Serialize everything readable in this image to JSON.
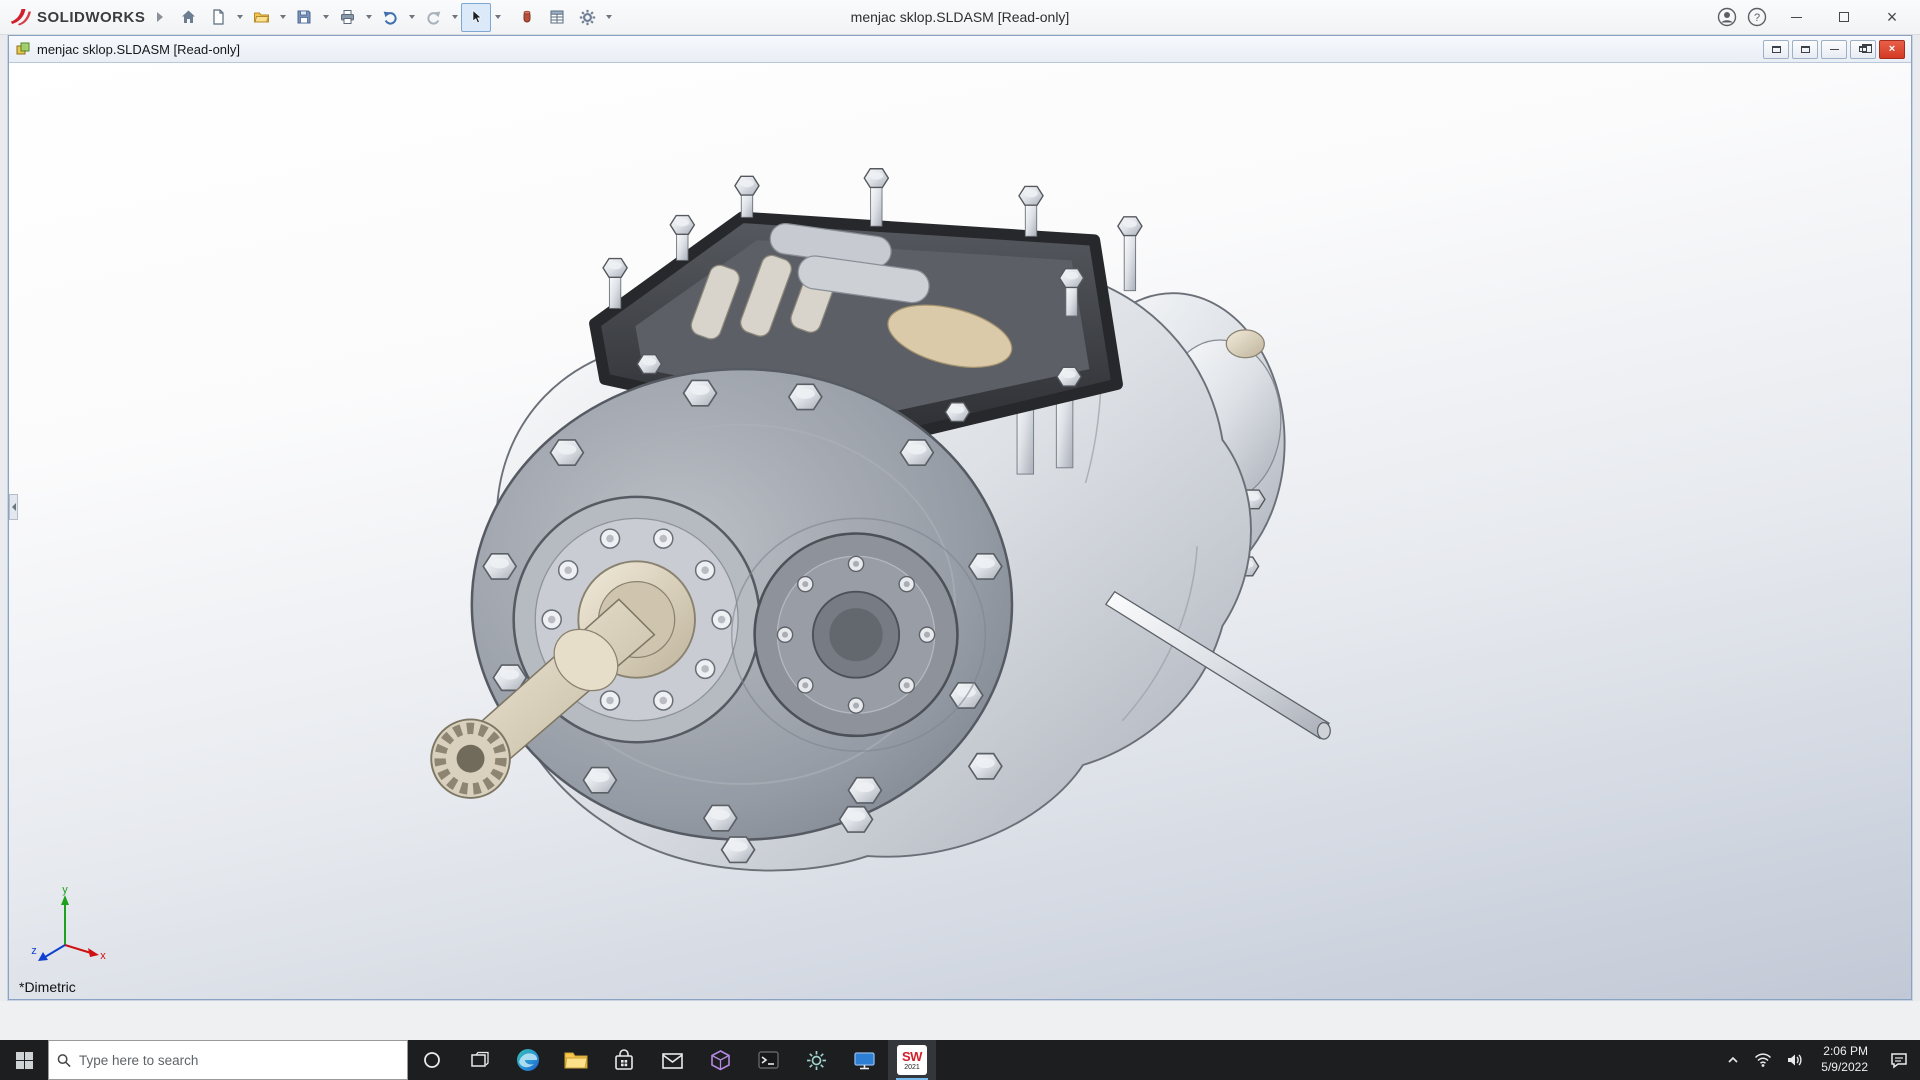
{
  "app": {
    "name": "SOLIDWORKS",
    "title_center": "menjac sklop.SLDASM [Read-only]"
  },
  "window_controls": {
    "help": "?",
    "close": "×"
  },
  "toolbar": {
    "buttons": [
      "home",
      "new",
      "open",
      "save",
      "print",
      "undo",
      "redo",
      "select",
      "rebuild",
      "file-properties",
      "options"
    ]
  },
  "doc_window": {
    "title": "menjac sklop.SLDASM [Read-only]",
    "close": "×"
  },
  "viewport": {
    "view_label": "*Dimetric",
    "triad": {
      "x": "x",
      "y": "y",
      "z": "z"
    }
  },
  "taskbar": {
    "search_placeholder": "Type here to search",
    "solidworks": {
      "letters": "SW",
      "year": "2021"
    },
    "tray": {
      "time": "2:06 PM",
      "date": "5/9/2022"
    }
  }
}
